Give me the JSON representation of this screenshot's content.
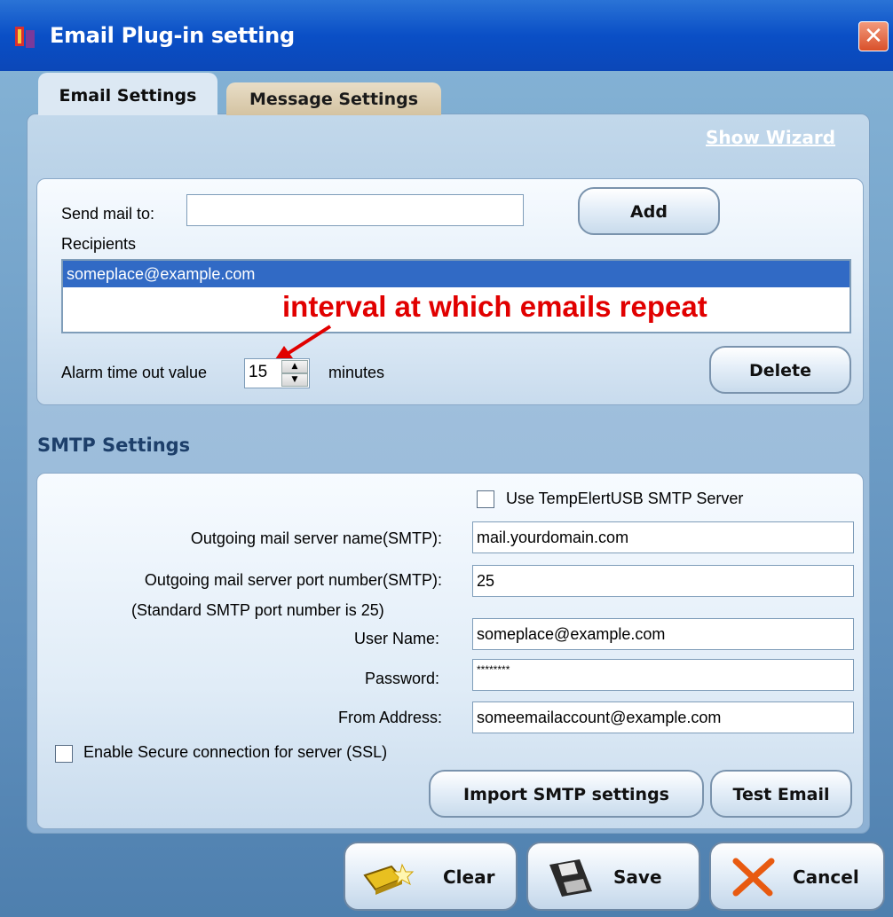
{
  "window": {
    "title": "Email Plug-in setting"
  },
  "tabs": [
    {
      "label": "Email Settings",
      "active": true
    },
    {
      "label": "Message Settings",
      "active": false
    }
  ],
  "show_wizard_label": "Show Wizard",
  "recipients_group": {
    "send_mail_label": "Send mail to:",
    "send_mail_value": "",
    "add_label": "Add",
    "recipients_label": "Recipients",
    "recipients": [
      "someplace@example.com"
    ],
    "annotation": "interval at which emails repeat",
    "alarm_label": "Alarm time out value",
    "alarm_value": "15",
    "alarm_unit": "minutes",
    "delete_label": "Delete"
  },
  "smtp": {
    "section_title": "SMTP Settings",
    "use_server_label": "Use TempElertUSB SMTP Server",
    "use_server_checked": false,
    "server_name_label": "Outgoing mail server name(SMTP):",
    "server_name_value": "mail.yourdomain.com",
    "port_label": "Outgoing mail server port number(SMTP):",
    "port_value": "25",
    "port_hint": "(Standard SMTP port number is 25)",
    "username_label": "User Name:",
    "username_value": "someplace@example.com",
    "password_label": "Password:",
    "password_value": "********",
    "from_label": "From Address:",
    "from_value": "someemailaccount@example.com",
    "ssl_label": "Enable Secure connection for server (SSL)",
    "ssl_checked": false,
    "import_label": "Import SMTP settings",
    "test_label": "Test Email"
  },
  "footer": {
    "clear_label": "Clear",
    "save_label": "Save",
    "cancel_label": "Cancel"
  },
  "colors": {
    "titlebar": "#0a4fc6",
    "selection": "#316ac5",
    "annotation": "#e10000",
    "section_title": "#1d3f6a"
  }
}
